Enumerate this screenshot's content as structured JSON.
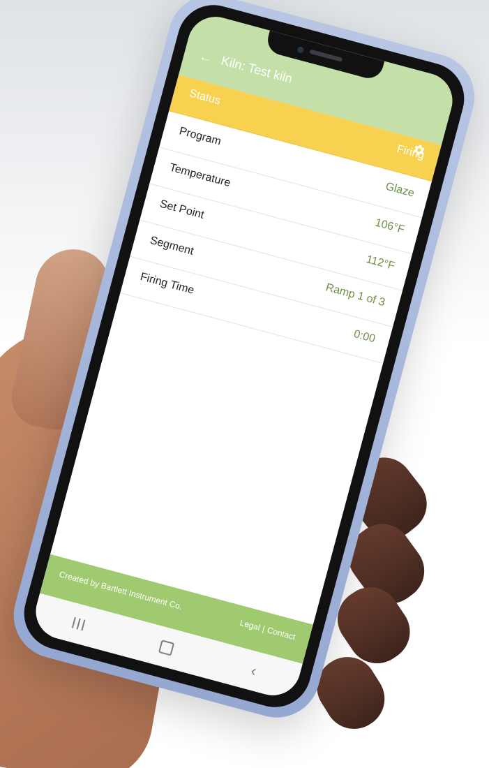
{
  "header": {
    "title": "Kiln: Test kiln"
  },
  "icons": {
    "back": "←",
    "settings": "gear-icon"
  },
  "status": {
    "label": "Status",
    "value": "Firing"
  },
  "rows": [
    {
      "label": "Program",
      "value": "Glaze"
    },
    {
      "label": "Temperature",
      "value": "106°F"
    },
    {
      "label": "Set Point",
      "value": "112°F"
    },
    {
      "label": "Segment",
      "value": "Ramp 1 of 3"
    },
    {
      "label": "Firing Time",
      "value": "0:00"
    }
  ],
  "footer": {
    "created_by": "Created by Bartlett Instrument Co.",
    "legal": "Legal",
    "separator": "|",
    "contact": "Contact"
  },
  "colors": {
    "header": "#c4dfa8",
    "status": "#f7d14f",
    "footer": "#9fca6f",
    "value_text": "#6e8f48"
  }
}
